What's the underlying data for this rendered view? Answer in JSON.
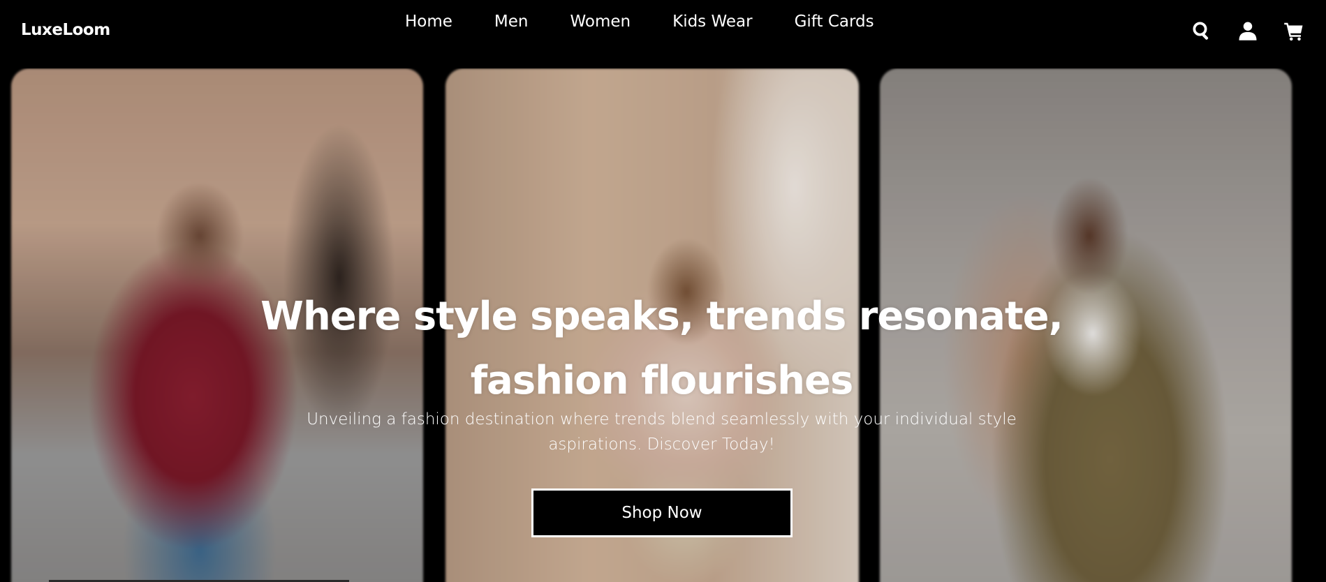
{
  "header": {
    "logo": "LuxeLoom",
    "nav": [
      {
        "label": "Home"
      },
      {
        "label": "Men"
      },
      {
        "label": "Women"
      },
      {
        "label": "Kids Wear"
      },
      {
        "label": "Gift Cards"
      }
    ],
    "icons": [
      "search-icon",
      "user-icon",
      "cart-icon"
    ]
  },
  "hero": {
    "title": "Where style speaks, trends resonate, fashion flourishes",
    "subtitle": "Unveiling a fashion destination where trends blend seamlessly with your individual style aspirations. Discover Today!",
    "cta_label": "Shop Now",
    "panels": [
      {
        "subject": "man in burgundy sweater and jeans"
      },
      {
        "subject": "woman in blush jacket on street"
      },
      {
        "subject": "woman in olive trench and trousers"
      }
    ]
  },
  "colors": {
    "background": "#000000",
    "text": "#ffffff",
    "button_bg": "#000000",
    "button_border": "#ffffff"
  }
}
